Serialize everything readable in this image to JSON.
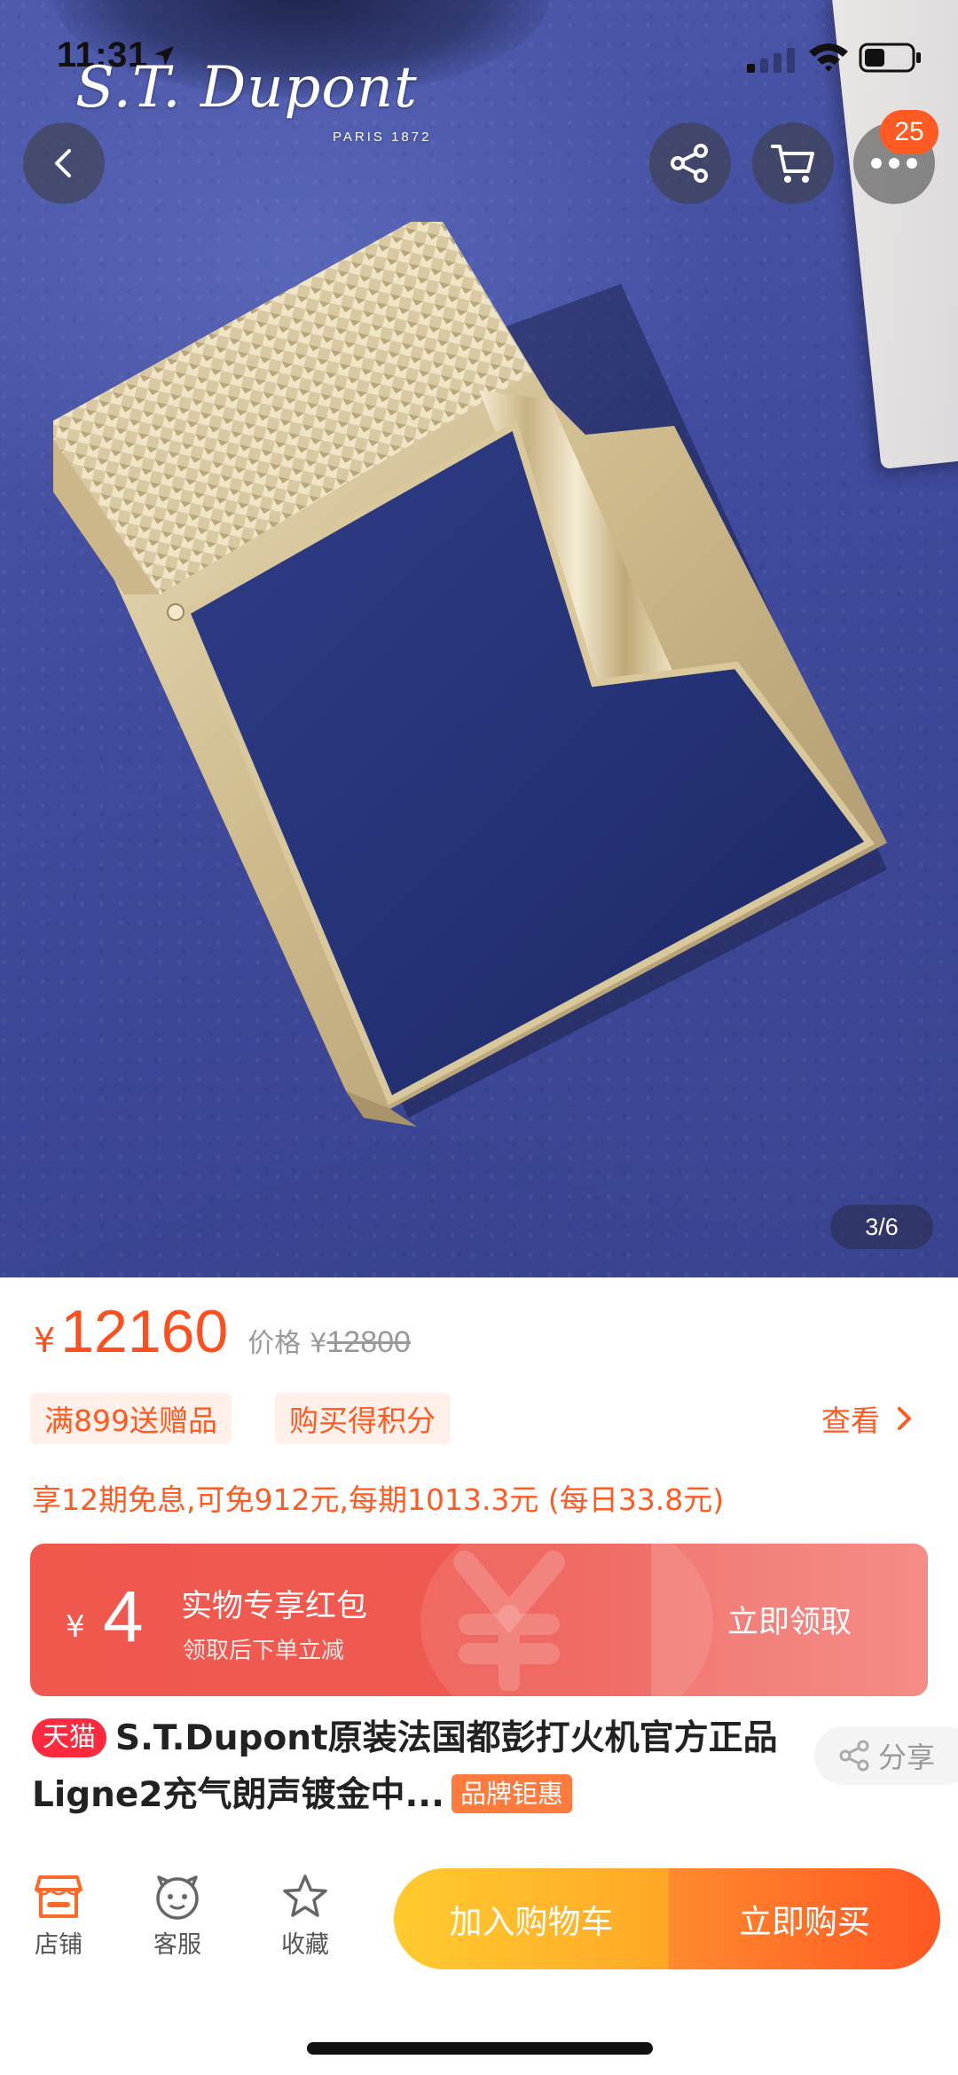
{
  "status_bar": {
    "time": "11:31"
  },
  "product_image": {
    "brand_logo_text": "S.T. Dupont",
    "brand_logo_sub": "PARIS 1872",
    "counter": "3/6"
  },
  "header": {
    "cart_badge_count": "25"
  },
  "price": {
    "currency": "¥",
    "current": "12160",
    "original_label": "价格",
    "original_currency": "¥",
    "original": "12800"
  },
  "promos": {
    "tags": [
      "满899送赠品",
      "购买得积分"
    ],
    "view_label": "查看"
  },
  "installment_text": "享12期免息,可免912元,每期1013.3元 (每日33.8元)",
  "coupon": {
    "currency": "¥",
    "amount": "4",
    "title": "实物专享红包",
    "subtitle": "领取后下单立减",
    "cta": "立即领取"
  },
  "title": {
    "platform_tag": "天猫",
    "text": "S.T.Dupont原装法国都彭打火机官方正品Ligne2充气朗声镀金中...",
    "brand_tag": "品牌钜惠",
    "share_label": "分享"
  },
  "bottom_bar": {
    "shop_label": "店铺",
    "service_label": "客服",
    "favorite_label": "收藏",
    "add_to_cart_label": "加入购物车",
    "buy_now_label": "立即购买"
  },
  "colors": {
    "accent": "#ff5a22",
    "coupon_red": "#f0584e",
    "tmall_red": "#ff2a3d"
  }
}
